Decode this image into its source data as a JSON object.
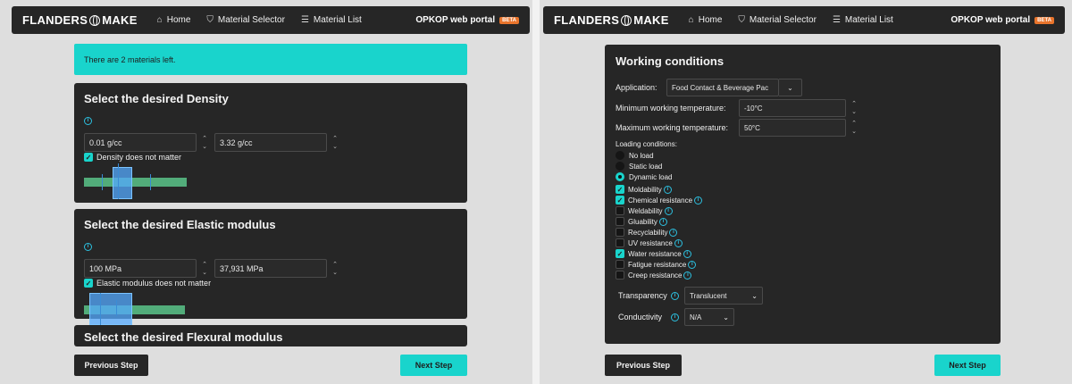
{
  "left": {
    "navbar": {
      "brand_left": "FLANDERS",
      "brand_right": "MAKE",
      "home": "Home",
      "selector": "Material Selector",
      "list": "Material List",
      "portal": "OPKOP web portal",
      "beta": "BETA"
    },
    "alert": "There are 2 materials left.",
    "density": {
      "title": "Select the desired Density",
      "min": "0.01 g/cc",
      "max": "3.32 g/cc",
      "checkbox": "Density does not matter"
    },
    "elastic": {
      "title": "Select the desired Elastic modulus",
      "min": "100 MPa",
      "max": "37,931 MPa",
      "checkbox": "Elastic modulus does not matter"
    },
    "flexural": {
      "title": "Select the desired Flexural modulus"
    },
    "prev": "Previous Step",
    "next": "Next Step"
  },
  "right": {
    "navbar": {
      "brand_left": "FLANDERS",
      "brand_right": "MAKE",
      "home": "Home",
      "selector": "Material Selector",
      "list": "Material List",
      "portal": "OPKOP web portal",
      "beta": "BETA"
    },
    "title": "Working conditions",
    "application_label": "Application:",
    "application_value": "Food Contact & Beverage Pac",
    "min_temp_label": "Minimum working temperature:",
    "min_temp_value": "-10°C",
    "max_temp_label": "Maximum working temperature:",
    "max_temp_value": "50°C",
    "loading_label": "Loading conditions:",
    "loading": [
      "No load",
      "Static load",
      "Dynamic load"
    ],
    "loading_selected": 2,
    "properties": [
      {
        "label": "Moldability",
        "checked": true
      },
      {
        "label": "Chemical resistance",
        "checked": true
      },
      {
        "label": "Weldability",
        "checked": false
      },
      {
        "label": "Gluability",
        "checked": false
      },
      {
        "label": "Recyclability",
        "checked": false
      },
      {
        "label": "UV resistance",
        "checked": false
      },
      {
        "label": "Water resistance",
        "checked": true
      },
      {
        "label": "Fatigue resistance",
        "checked": false
      },
      {
        "label": "Creep resistance",
        "checked": false
      }
    ],
    "transparency_label": "Transparency",
    "transparency_value": "Translucent",
    "conductivity_label": "Conductivity",
    "conductivity_value": "N/A",
    "prev": "Previous Step",
    "next": "Next Step"
  },
  "colors": {
    "accent": "#19d4cc",
    "card": "#262626",
    "beta": "#e8742c"
  }
}
